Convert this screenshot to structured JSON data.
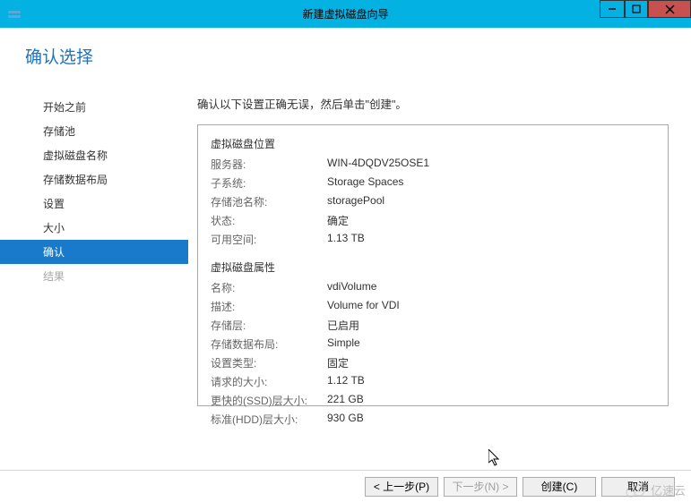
{
  "window": {
    "title": "新建虚拟磁盘向导",
    "minimize": "–",
    "maximize": "□",
    "close": "✕"
  },
  "page_title": "确认选择",
  "sidebar": {
    "items": [
      {
        "label": "开始之前"
      },
      {
        "label": "存储池"
      },
      {
        "label": "虚拟磁盘名称"
      },
      {
        "label": "存储数据布局"
      },
      {
        "label": "设置"
      },
      {
        "label": "大小"
      },
      {
        "label": "确认"
      },
      {
        "label": "结果"
      }
    ]
  },
  "instruction": "确认以下设置正确无误，然后单击\"创建\"。",
  "section1": {
    "title": "虚拟磁盘位置",
    "server_label": "服务器:",
    "server_value": "WIN-4DQDV25OSE1",
    "subsystem_label": "子系统:",
    "subsystem_value": "Storage Spaces",
    "poolname_label": "存储池名称:",
    "poolname_value": "storagePool",
    "status_label": "状态:",
    "status_value": "确定",
    "available_label": "可用空间:",
    "available_value": "1.13 TB"
  },
  "section2": {
    "title": "虚拟磁盘属性",
    "name_label": "名称:",
    "name_value": "vdiVolume",
    "desc_label": "描述:",
    "desc_value": "Volume for VDI",
    "tier_label": "存储层:",
    "tier_value": "已启用",
    "layout_label": "存储数据布局:",
    "layout_value": "Simple",
    "prov_label": "设置类型:",
    "prov_value": "固定",
    "reqsize_label": "请求的大小:",
    "reqsize_value": "1.12 TB",
    "ssd_label": "更快的(SSD)层大小:",
    "ssd_value": "221 GB",
    "hdd_label": "标准(HDD)层大小:",
    "hdd_value": "930 GB"
  },
  "footer": {
    "prev": "< 上一步(P)",
    "next": "下一步(N) >",
    "create": "创建(C)",
    "cancel": "取消"
  },
  "watermark": "亿速云"
}
